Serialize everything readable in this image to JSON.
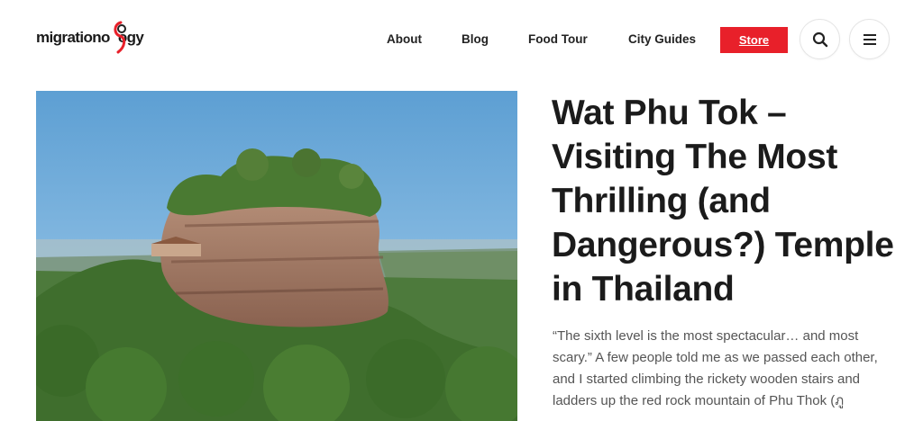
{
  "brand": {
    "logo_text_left": "migrationo",
    "logo_text_right": "ogy",
    "accent": "#e8202a"
  },
  "nav": {
    "items": [
      {
        "label": "About"
      },
      {
        "label": "Blog"
      },
      {
        "label": "Food Tour"
      },
      {
        "label": "City Guides"
      }
    ],
    "store_label": "Store",
    "search_icon": "search-icon",
    "menu_icon": "hamburger-menu-icon"
  },
  "article": {
    "title": "Wat Phu Tok – Visiting The Most Thrilling (and Dangerous?) Temple in Thailand",
    "excerpt": "“The sixth level is the most spectacular… and most scary.” A few people told me as we passed each other, and I started climbing the rickety wooden stairs and ladders up the red rock mountain of Phu Thok (ภู"
  }
}
